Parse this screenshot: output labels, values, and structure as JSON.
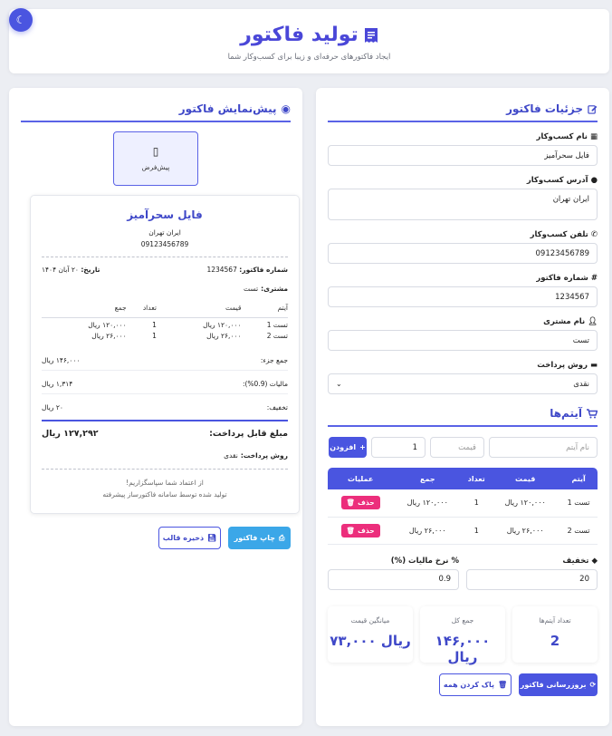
{
  "header": {
    "title": "تولید فاکتور",
    "subtitle": "ایجاد فاکتورهای حرفه‌ای و زیبا برای کسب‌وکار شما"
  },
  "theme": {
    "accent": "#4a55e0",
    "danger": "#ec2e7c",
    "info": "#3ba7e8"
  },
  "form": {
    "title": "جزئیات فاکتور",
    "business_name_label": "نام کسب‌وکار",
    "business_name": "فایل سحرآمیز",
    "business_address_label": "آدرس کسب‌وکار",
    "business_address": "ایران تهران",
    "business_phone_label": "تلفن کسب‌وکار",
    "business_phone": "09123456789",
    "invoice_number_label": "شماره فاکتور",
    "invoice_number": "1234567",
    "customer_name_label": "نام مشتری",
    "customer_name": "تست",
    "payment_method_label": "روش پرداخت",
    "payment_method": "نقدی"
  },
  "items_section": {
    "title": "آیتم‌ها",
    "item_name_placeholder": "نام آیتم",
    "price_placeholder": "قیمت",
    "quantity_value": "1",
    "add_label": "افزودن",
    "headers": [
      "آیتم",
      "قیمت",
      "تعداد",
      "جمع",
      "عملیات"
    ],
    "rows": [
      {
        "name": "تست 1",
        "price": "۱۲۰,۰۰۰ ریال",
        "qty": "1",
        "total": "۱۲۰,۰۰۰ ریال",
        "action": "حذف"
      },
      {
        "name": "تست 2",
        "price": "۲۶,۰۰۰ ریال",
        "qty": "1",
        "total": "۲۶,۰۰۰ ریال",
        "action": "حذف"
      }
    ],
    "tax_label": "نرخ مالیات (%)",
    "tax_value": "0.9",
    "discount_label": "تخفیف",
    "discount_value": "20"
  },
  "stats": {
    "count_label": "تعداد آیتم‌ها",
    "count_value": "2",
    "total_label": "جمع کل",
    "total_value": "۱۴۶,۰۰۰ ریال",
    "avg_label": "میانگین قیمت",
    "avg_value": "۷۳,۰۰۰ ریال"
  },
  "actions": {
    "update_label": "بروزرسانی فاکتور",
    "clear_label": "پاک کردن همه"
  },
  "preview": {
    "title": "پیش‌نمایش فاکتور",
    "template_label": "پیش‌فرض",
    "business_name": "فایل سحرآمیز",
    "address": "ایران تهران",
    "phone": "09123456789",
    "invoice_no_label": "شماره فاکتور:",
    "invoice_no": "1234567",
    "date_label": "تاریخ:",
    "date": "۲۰ آبان ۱۴۰۴",
    "customer_label": "مشتری:",
    "customer": "تست",
    "headers": [
      "آیتم",
      "قیمت",
      "تعداد",
      "جمع"
    ],
    "rows": [
      {
        "name": "تست 1",
        "price": "۱۲۰,۰۰۰ ریال",
        "qty": "1",
        "total": "۱۲۰,۰۰۰ ریال"
      },
      {
        "name": "تست 2",
        "price": "۲۶,۰۰۰ ریال",
        "qty": "1",
        "total": "۲۶,۰۰۰ ریال"
      }
    ],
    "subtotal_label": "جمع جزء:",
    "subtotal": "۱۴۶,۰۰۰ ریال",
    "tax_label": "مالیات (0.9%):",
    "tax": "۱,۳۱۴ ریال",
    "discount_label": "تخفیف:",
    "discount": "۲۰ ریال",
    "payable_label": "مبلغ قابل پرداخت:",
    "payable": "۱۲۷,۲۹۲ ریال",
    "payment_label": "روش پرداخت:",
    "payment": "نقدی",
    "thanks": "از اعتماد شما سپاسگزاریم!",
    "footer": "تولید شده توسط سامانه فاکتورساز پیشرفته",
    "print_label": "چاپ فاکتور",
    "save_label": "ذخیره قالب"
  }
}
